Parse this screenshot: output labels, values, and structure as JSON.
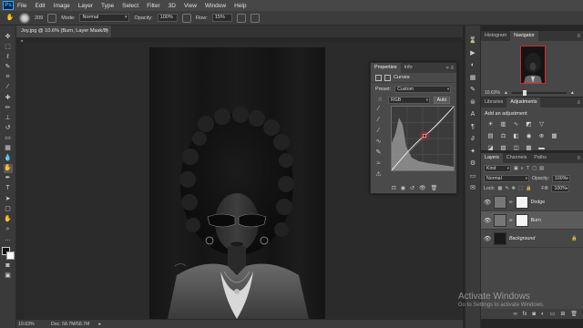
{
  "app": {
    "logo": "Ps"
  },
  "menu": [
    "File",
    "Edit",
    "Image",
    "Layer",
    "Type",
    "Select",
    "Filter",
    "3D",
    "View",
    "Window",
    "Help"
  ],
  "options": {
    "brush_size": "209",
    "mode_label": "Mode:",
    "mode_value": "Normal",
    "opacity_label": "Opacity:",
    "opacity_value": "100%",
    "flow_label": "Flow:",
    "flow_value": "15%"
  },
  "document": {
    "tab_title": "Joy.jpg @ 10.6% (Burn, Layer Mask/8) *",
    "zoom": "10.63%",
    "doc_info": "Doc: 58.7M/58.7M"
  },
  "properties": {
    "tabs": [
      "Properties",
      "Info"
    ],
    "header": "Curves",
    "preset_label": "Preset:",
    "preset_value": "Custom",
    "channel_value": "RGB",
    "auto_label": "Auto"
  },
  "navigator": {
    "tabs": [
      "Histogram",
      "Navigator"
    ],
    "zoom": "10.63%"
  },
  "adjustments": {
    "tabs": [
      "Libraries",
      "Adjustments"
    ],
    "title": "Add an adjustment"
  },
  "layers": {
    "tabs": [
      "Layers",
      "Channels",
      "Paths"
    ],
    "filter_value": "Kind",
    "blend_value": "Normal",
    "opacity_label": "Opacity:",
    "opacity_value": "100%",
    "lock_label": "Lock:",
    "fill_label": "Fill:",
    "fill_value": "100%",
    "items": [
      {
        "name": "Dodge"
      },
      {
        "name": "Burn"
      },
      {
        "name": "Background"
      }
    ]
  },
  "watermark": {
    "line1": "Activate Windows",
    "line2": "Go to Settings to activate Windows."
  },
  "colors": {
    "accent": "#31a8ff",
    "nav_frame": "#e02525",
    "curve_point": "#e02525"
  }
}
